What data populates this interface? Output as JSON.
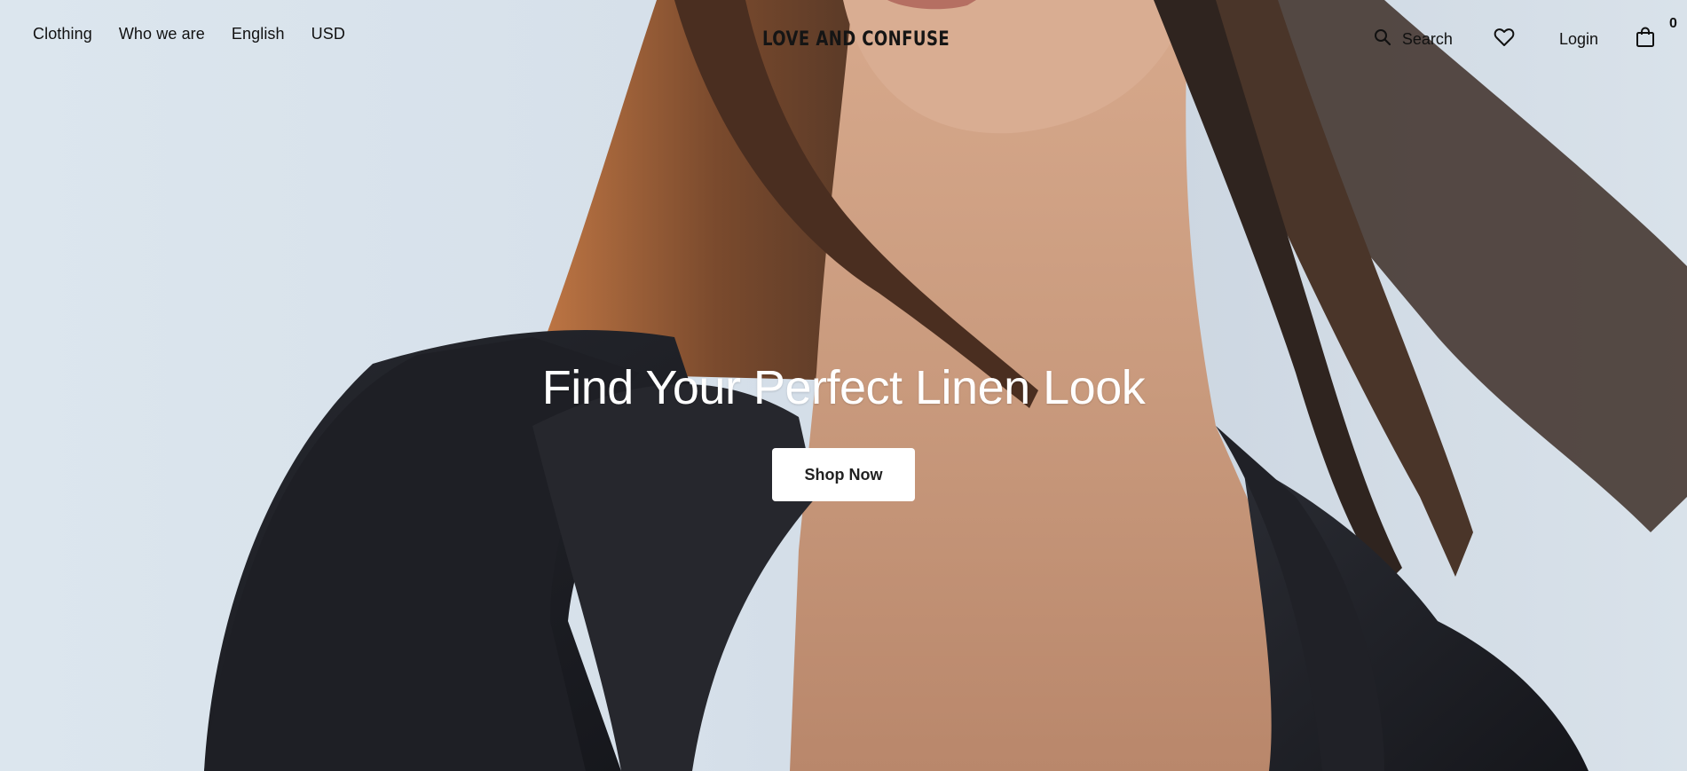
{
  "nav": {
    "clothing": "Clothing",
    "who_we_are": "Who we are",
    "language": "English",
    "currency": "USD"
  },
  "brand": {
    "logo": "LOVE AND CONFUSE"
  },
  "actions": {
    "search_label": "Search",
    "search_icon": "search-icon",
    "wishlist_icon": "heart-icon",
    "login_label": "Login",
    "cart_icon": "shopping-bag-icon",
    "cart_count": "0"
  },
  "hero": {
    "headline": "Find Your Perfect Linen Look",
    "cta_label": "Shop Now"
  },
  "colors": {
    "sky": "#d6e0ea",
    "jacket": "#1c1d22",
    "skin": "#c79a7e",
    "hair": "#5a3a28",
    "cta_bg": "#ffffff"
  }
}
